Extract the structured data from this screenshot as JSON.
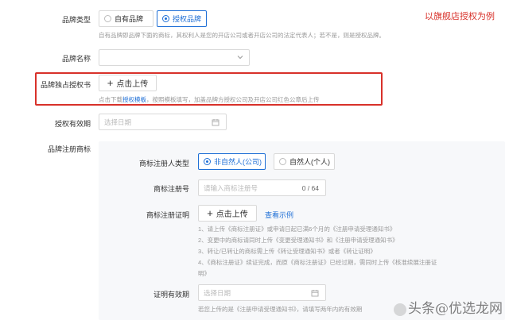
{
  "annotation": "以旗舰店授权为例",
  "brand_type": {
    "label": "品牌类型",
    "options": [
      {
        "label": "自有品牌",
        "selected": false
      },
      {
        "label": "授权品牌",
        "selected": true
      }
    ],
    "hint": "自有品牌即品牌下面的商标，其权利人是您的开店公司或者开店公司的法定代表人；若不是，则是授权品牌。"
  },
  "brand_name": {
    "label": "品牌名称",
    "value": ""
  },
  "exclusive_auth": {
    "label": "品牌独占授权书",
    "upload_label": "点击上传",
    "hint_pre": "点击下载",
    "hint_link": "授权模板",
    "hint_post": "，按照模板填写，加盖品牌方授权公司及开店公司红色公章后上传"
  },
  "auth_validity": {
    "label": "授权有效期",
    "placeholder": "选择日期"
  },
  "trademark": {
    "label": "品牌注册商标",
    "holder_type": {
      "label": "商标注册人类型",
      "options": [
        {
          "label": "非自然人(公司)",
          "selected": true
        },
        {
          "label": "自然人(个人)",
          "selected": false
        }
      ]
    },
    "reg_no": {
      "label": "商标注册号",
      "placeholder": "请输入商标注册号",
      "counter": "0 / 64"
    },
    "certificate": {
      "label": "商标注册证明",
      "upload_label": "点击上传",
      "example_link": "查看示例",
      "notes": [
        "1、请上传《商标注册证》或申请日起已满6个月的《注册申请受理通知书》",
        "2、变更中的商标请同时上传《变更受理通知书》和《注册申请受理通知书》",
        "3、转让/已转让的商标需上传《转让受理通知书》或者《转让证明》",
        "4、《商标注册证》续证完成，而原《商标注册证》已经过期，需同时上传《核准续展注册证",
        "明》"
      ]
    },
    "cert_validity": {
      "label": "证明有效期",
      "placeholder": "选择日期",
      "hint": "若您上传的是《注册申请受理通知书》，请填写两年内的有效期"
    }
  },
  "watermark": "头条@优选龙网"
}
